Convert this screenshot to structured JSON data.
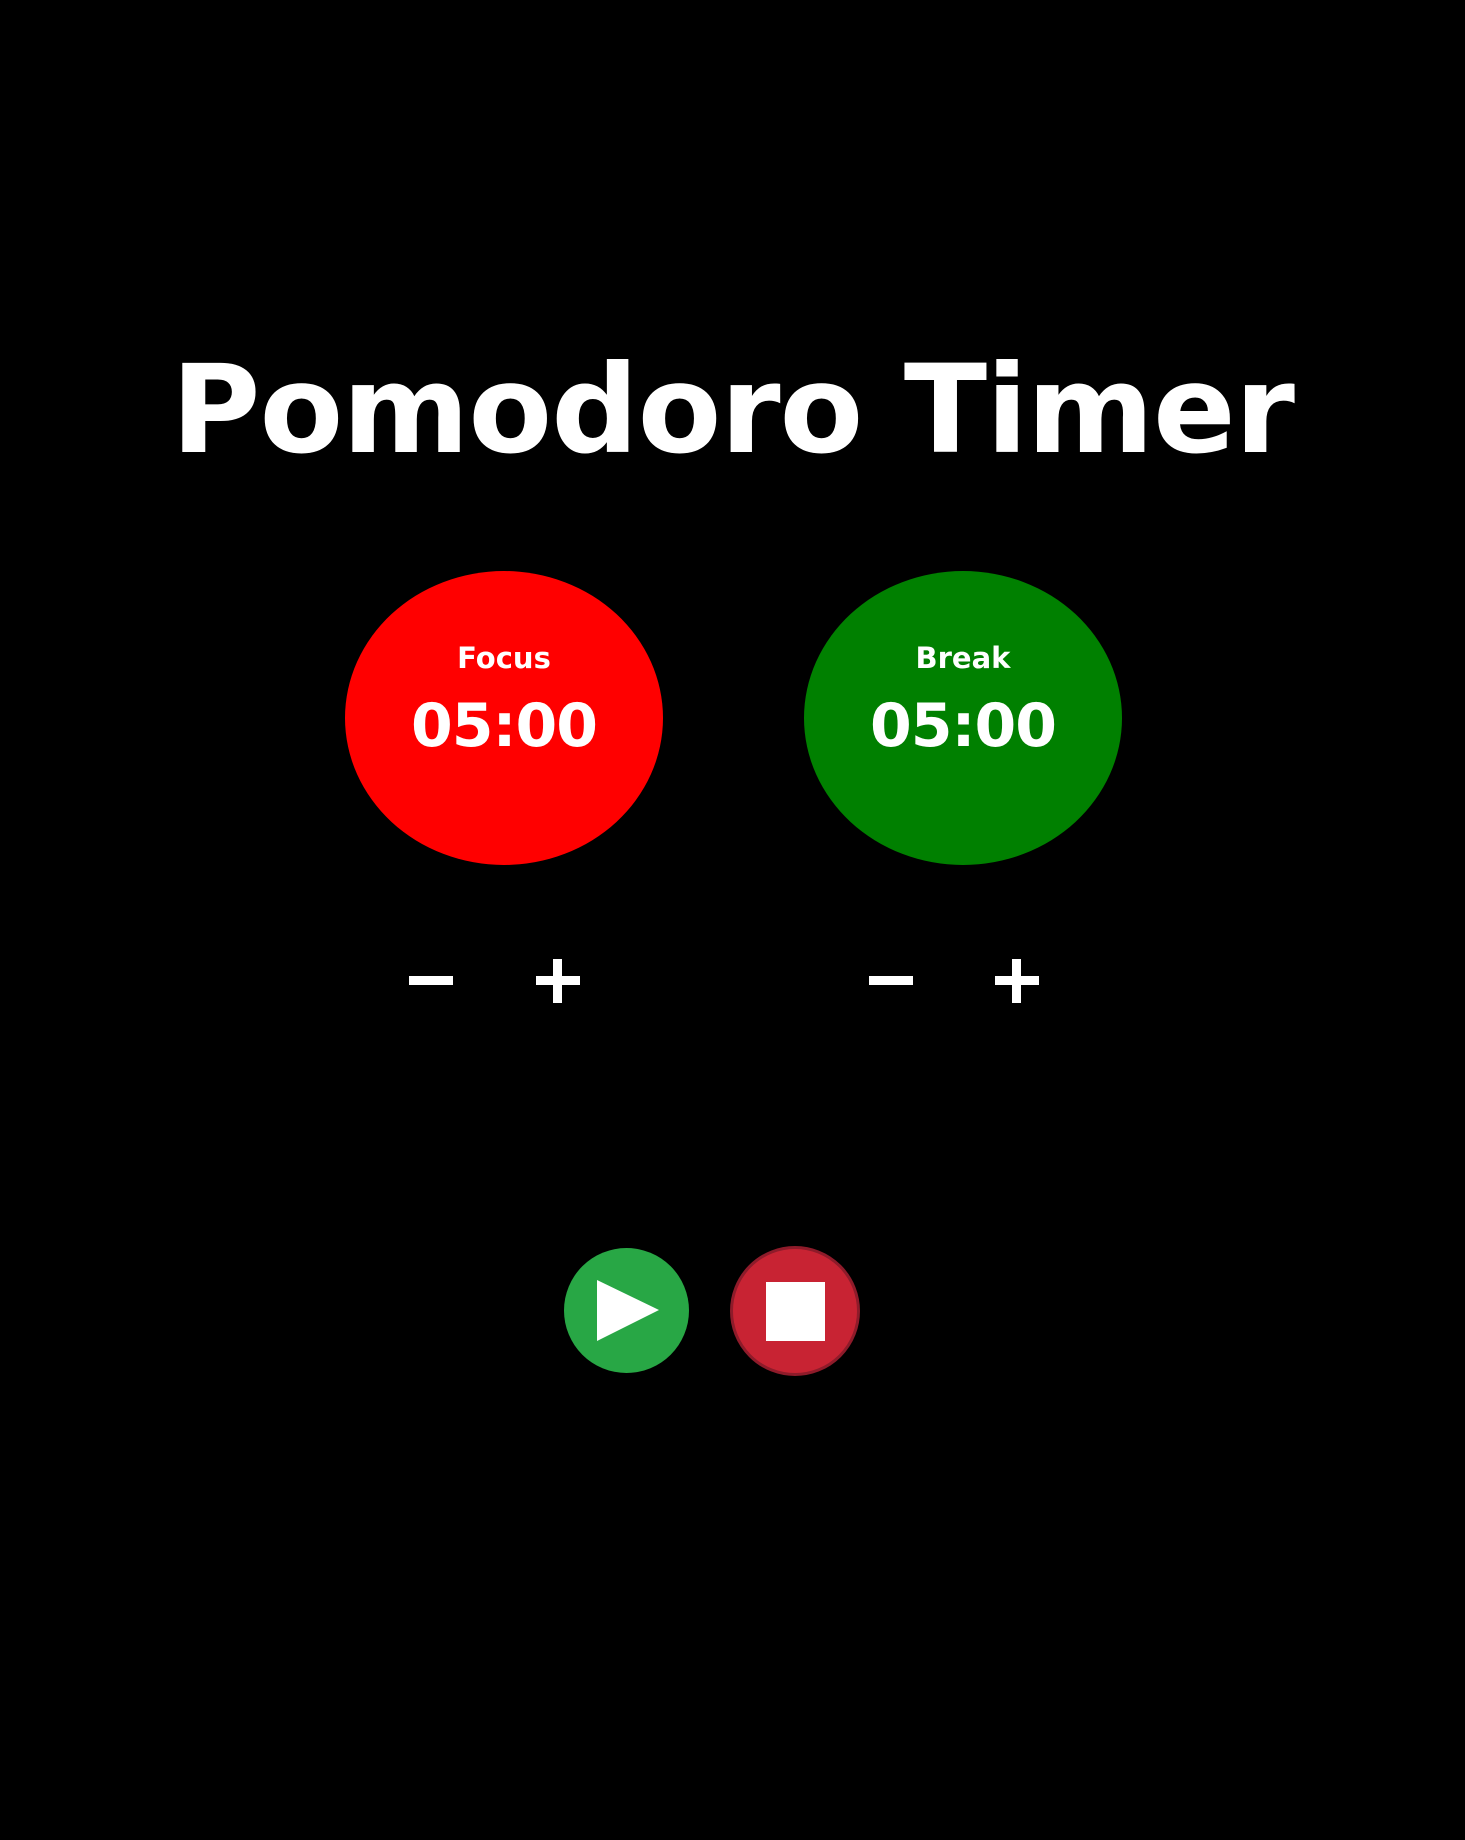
{
  "app": {
    "title": "Pomodoro Timer"
  },
  "timers": {
    "focus": {
      "label": "Focus",
      "time": "05:00",
      "color": "#ff0000",
      "decrease_icon": "minus-icon",
      "increase_icon": "plus-icon"
    },
    "break": {
      "label": "Break",
      "time": "05:00",
      "color": "#008000",
      "decrease_icon": "minus-icon",
      "increase_icon": "plus-icon"
    }
  },
  "controls": {
    "start": {
      "icon": "play-icon",
      "color": "#28a745"
    },
    "stop": {
      "icon": "stop-icon",
      "color": "#c82333"
    }
  },
  "theme": {
    "background": "#000000",
    "text": "#ffffff"
  }
}
